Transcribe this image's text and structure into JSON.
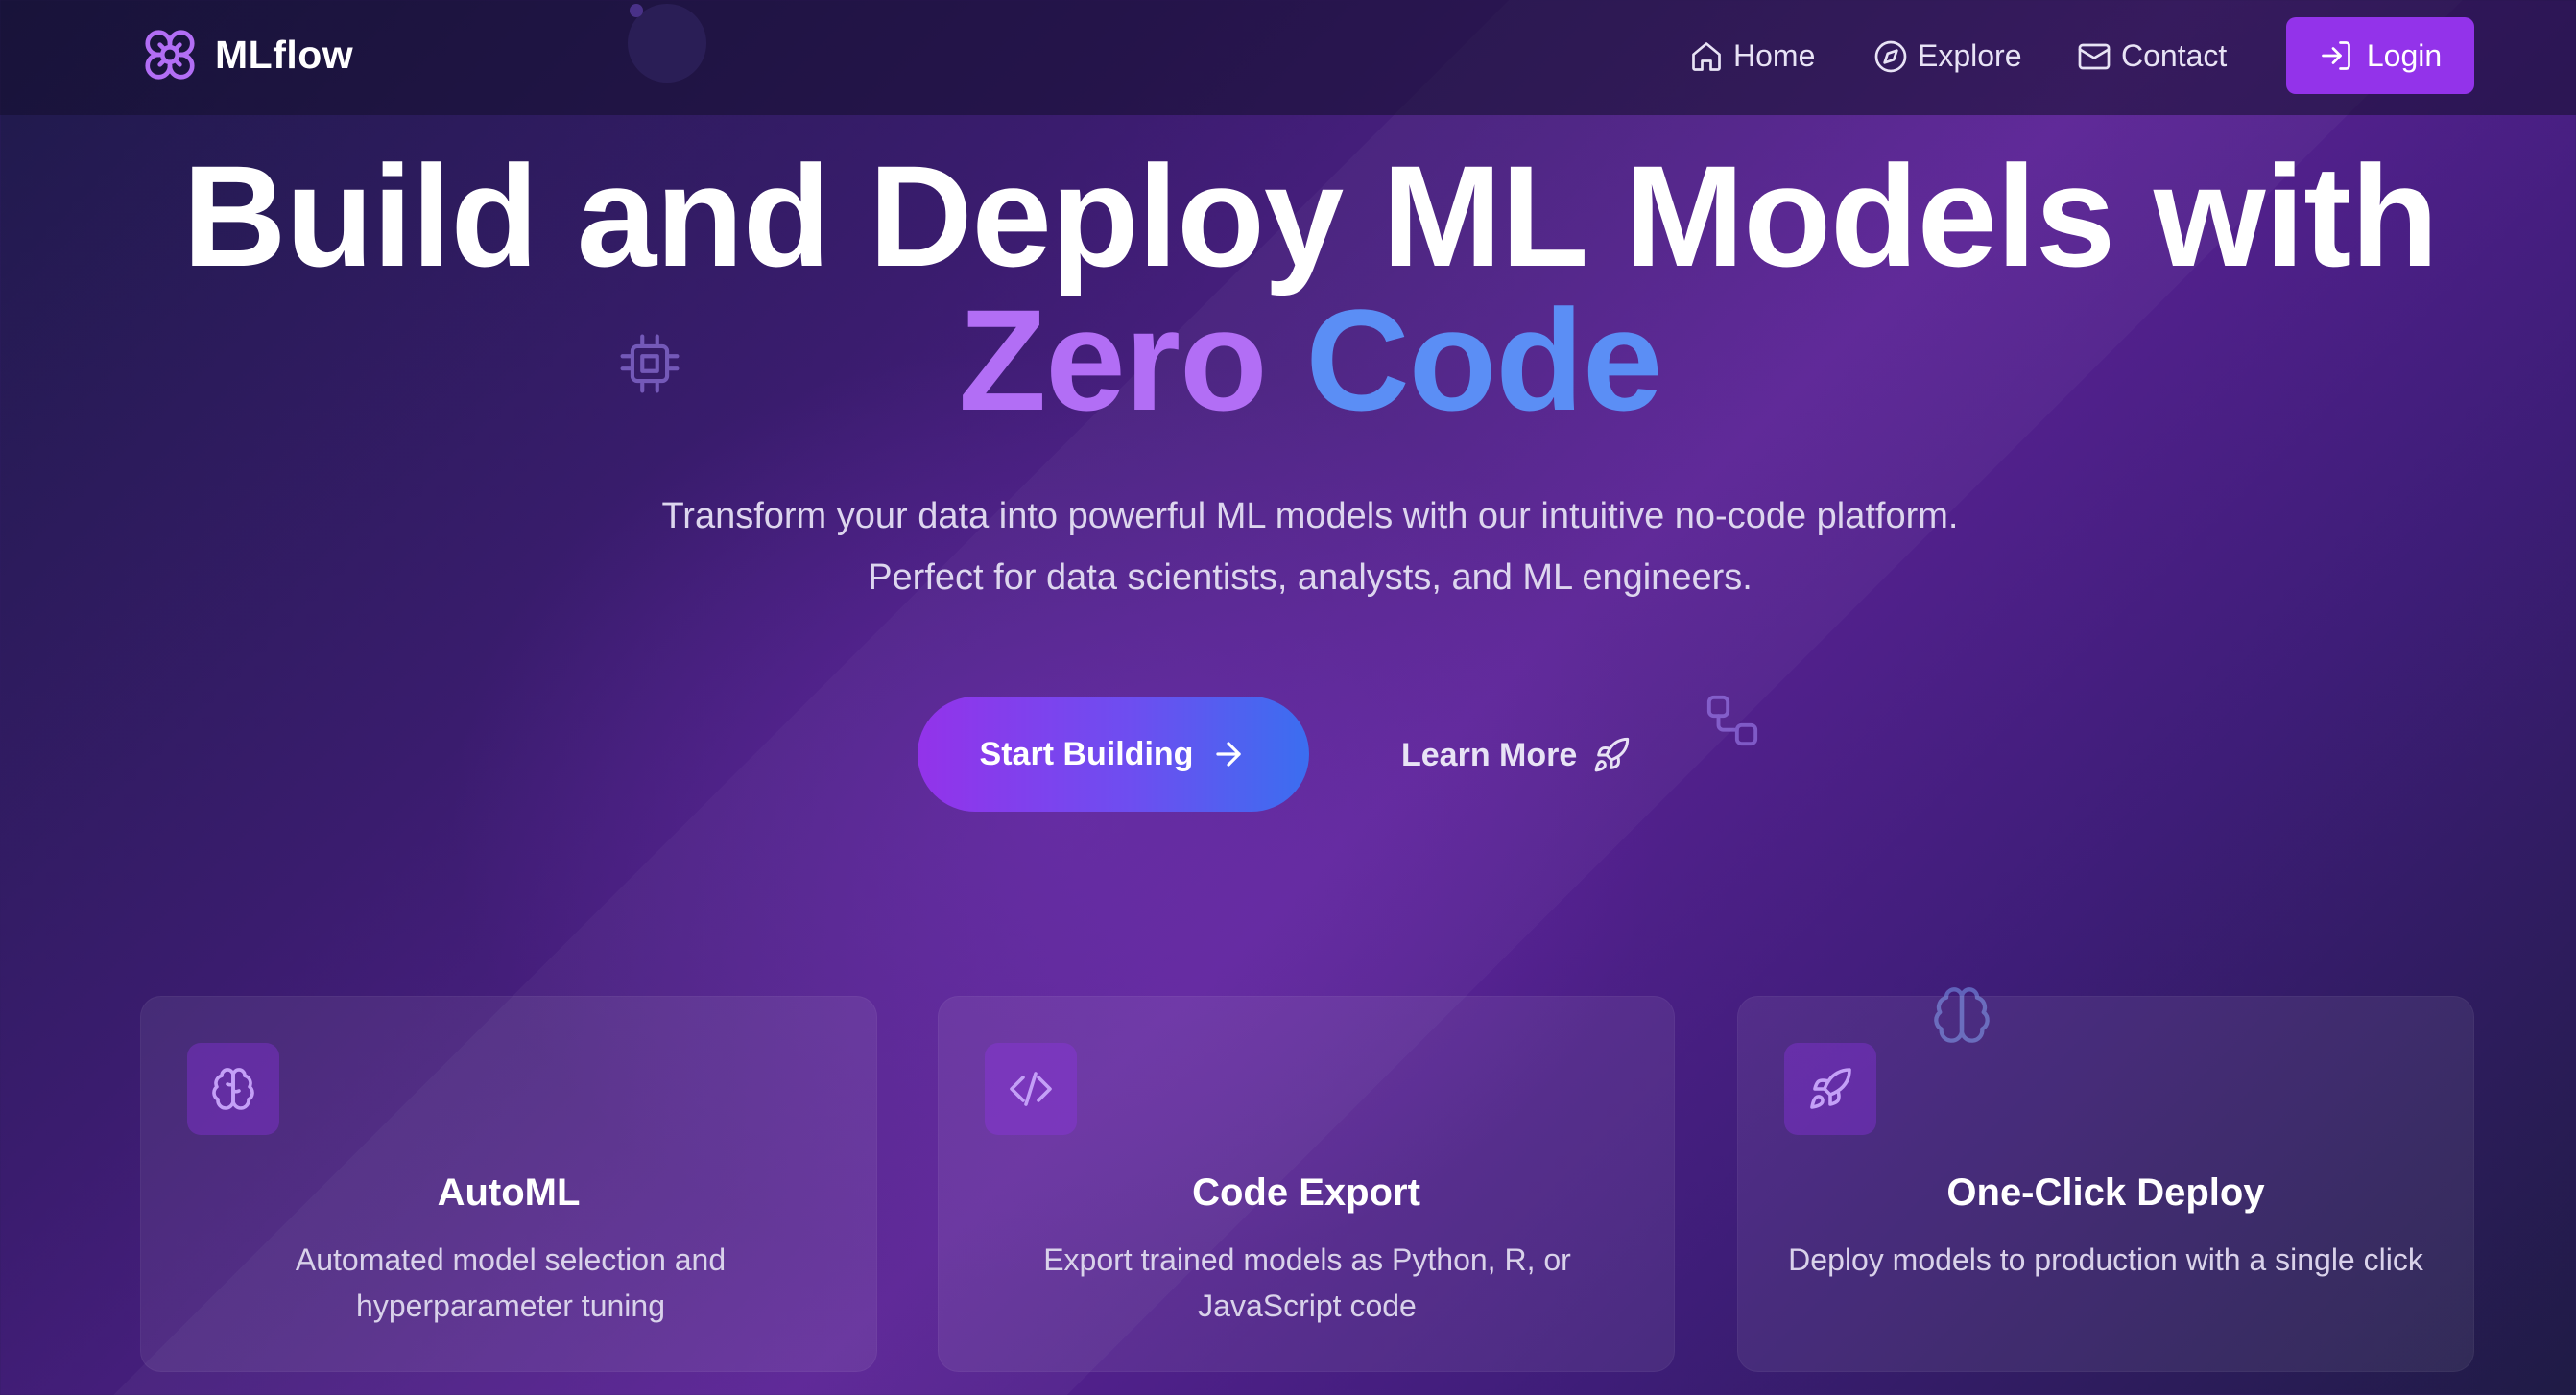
{
  "nav": {
    "brand": "MLflow",
    "logo_icon": "flower-gear-icon",
    "links": [
      {
        "label": "Home",
        "icon": "home-icon"
      },
      {
        "label": "Explore",
        "icon": "compass-icon"
      },
      {
        "label": "Contact",
        "icon": "mail-icon"
      }
    ],
    "login_label": "Login",
    "login_icon": "login-icon"
  },
  "hero": {
    "title_line1": "Build and Deploy ML Models with",
    "accent_word1": "Zero",
    "accent_word2": "Code",
    "subtitle_line1": "Transform your data into powerful ML models with our intuitive no-code platform.",
    "subtitle_line2": "Perfect for data scientists, analysts, and ML engineers.",
    "primary_cta": "Start Building",
    "secondary_cta": "Learn More"
  },
  "features": [
    {
      "title": "AutoML",
      "desc": "Automated model selection and hyperparameter tuning",
      "icon": "brain-icon"
    },
    {
      "title": "Code Export",
      "desc": "Export trained models as Python, R, or JavaScript code",
      "icon": "code-icon"
    },
    {
      "title": "One-Click Deploy",
      "desc": "Deploy models to production with a single click",
      "icon": "rocket-icon"
    }
  ],
  "colors": {
    "accent_purple": "#9333ea",
    "accent_gradient_start": "#b26ef5",
    "accent_gradient_end": "#5b8ef5",
    "background": "#3a1c6e"
  }
}
